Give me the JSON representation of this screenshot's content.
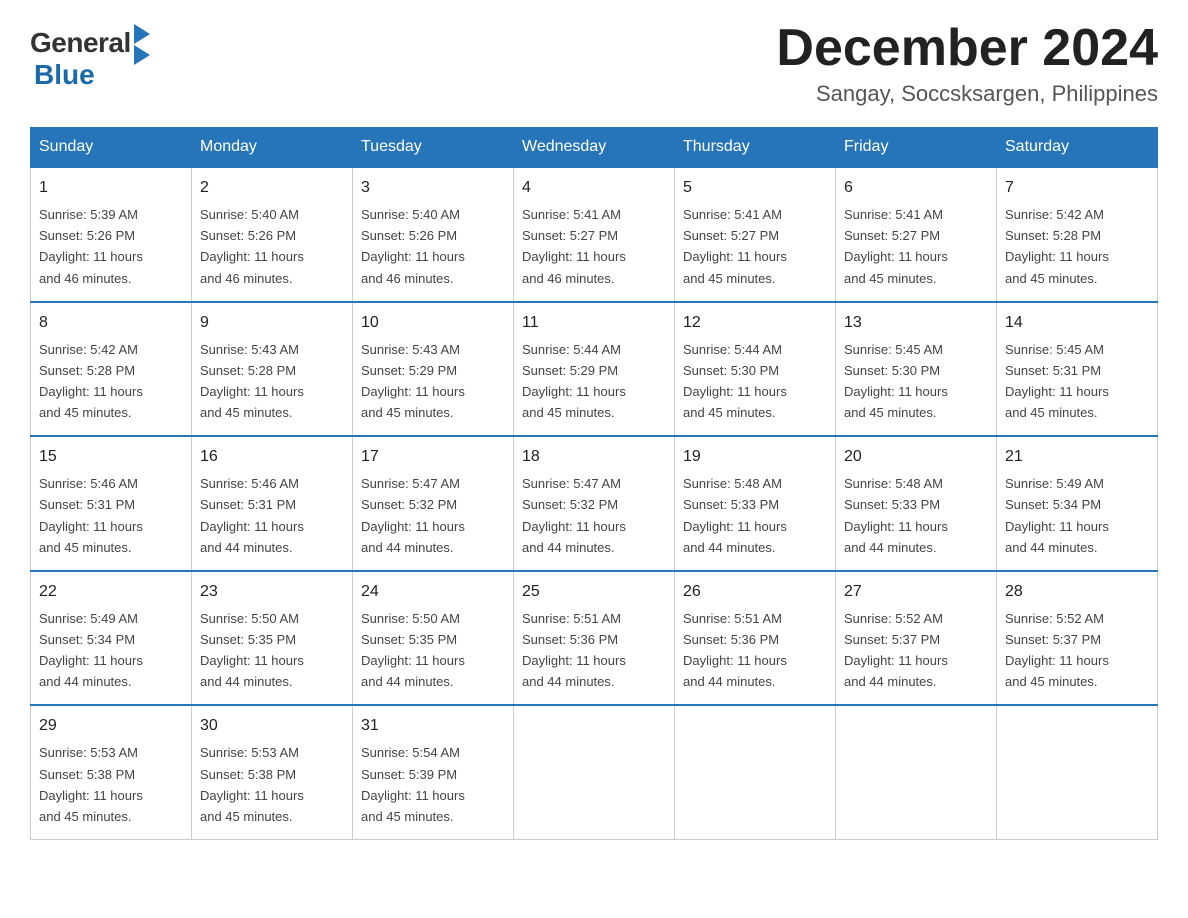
{
  "header": {
    "logo": {
      "general": "General",
      "blue": "Blue",
      "tagline": "Blue"
    },
    "title": "December 2024",
    "subtitle": "Sangay, Soccsksargen, Philippines"
  },
  "weekdays": [
    "Sunday",
    "Monday",
    "Tuesday",
    "Wednesday",
    "Thursday",
    "Friday",
    "Saturday"
  ],
  "weeks": [
    [
      {
        "day": "1",
        "sunrise": "5:39 AM",
        "sunset": "5:26 PM",
        "daylight": "11 hours and 46 minutes."
      },
      {
        "day": "2",
        "sunrise": "5:40 AM",
        "sunset": "5:26 PM",
        "daylight": "11 hours and 46 minutes."
      },
      {
        "day": "3",
        "sunrise": "5:40 AM",
        "sunset": "5:26 PM",
        "daylight": "11 hours and 46 minutes."
      },
      {
        "day": "4",
        "sunrise": "5:41 AM",
        "sunset": "5:27 PM",
        "daylight": "11 hours and 46 minutes."
      },
      {
        "day": "5",
        "sunrise": "5:41 AM",
        "sunset": "5:27 PM",
        "daylight": "11 hours and 45 minutes."
      },
      {
        "day": "6",
        "sunrise": "5:41 AM",
        "sunset": "5:27 PM",
        "daylight": "11 hours and 45 minutes."
      },
      {
        "day": "7",
        "sunrise": "5:42 AM",
        "sunset": "5:28 PM",
        "daylight": "11 hours and 45 minutes."
      }
    ],
    [
      {
        "day": "8",
        "sunrise": "5:42 AM",
        "sunset": "5:28 PM",
        "daylight": "11 hours and 45 minutes."
      },
      {
        "day": "9",
        "sunrise": "5:43 AM",
        "sunset": "5:28 PM",
        "daylight": "11 hours and 45 minutes."
      },
      {
        "day": "10",
        "sunrise": "5:43 AM",
        "sunset": "5:29 PM",
        "daylight": "11 hours and 45 minutes."
      },
      {
        "day": "11",
        "sunrise": "5:44 AM",
        "sunset": "5:29 PM",
        "daylight": "11 hours and 45 minutes."
      },
      {
        "day": "12",
        "sunrise": "5:44 AM",
        "sunset": "5:30 PM",
        "daylight": "11 hours and 45 minutes."
      },
      {
        "day": "13",
        "sunrise": "5:45 AM",
        "sunset": "5:30 PM",
        "daylight": "11 hours and 45 minutes."
      },
      {
        "day": "14",
        "sunrise": "5:45 AM",
        "sunset": "5:31 PM",
        "daylight": "11 hours and 45 minutes."
      }
    ],
    [
      {
        "day": "15",
        "sunrise": "5:46 AM",
        "sunset": "5:31 PM",
        "daylight": "11 hours and 45 minutes."
      },
      {
        "day": "16",
        "sunrise": "5:46 AM",
        "sunset": "5:31 PM",
        "daylight": "11 hours and 44 minutes."
      },
      {
        "day": "17",
        "sunrise": "5:47 AM",
        "sunset": "5:32 PM",
        "daylight": "11 hours and 44 minutes."
      },
      {
        "day": "18",
        "sunrise": "5:47 AM",
        "sunset": "5:32 PM",
        "daylight": "11 hours and 44 minutes."
      },
      {
        "day": "19",
        "sunrise": "5:48 AM",
        "sunset": "5:33 PM",
        "daylight": "11 hours and 44 minutes."
      },
      {
        "day": "20",
        "sunrise": "5:48 AM",
        "sunset": "5:33 PM",
        "daylight": "11 hours and 44 minutes."
      },
      {
        "day": "21",
        "sunrise": "5:49 AM",
        "sunset": "5:34 PM",
        "daylight": "11 hours and 44 minutes."
      }
    ],
    [
      {
        "day": "22",
        "sunrise": "5:49 AM",
        "sunset": "5:34 PM",
        "daylight": "11 hours and 44 minutes."
      },
      {
        "day": "23",
        "sunrise": "5:50 AM",
        "sunset": "5:35 PM",
        "daylight": "11 hours and 44 minutes."
      },
      {
        "day": "24",
        "sunrise": "5:50 AM",
        "sunset": "5:35 PM",
        "daylight": "11 hours and 44 minutes."
      },
      {
        "day": "25",
        "sunrise": "5:51 AM",
        "sunset": "5:36 PM",
        "daylight": "11 hours and 44 minutes."
      },
      {
        "day": "26",
        "sunrise": "5:51 AM",
        "sunset": "5:36 PM",
        "daylight": "11 hours and 44 minutes."
      },
      {
        "day": "27",
        "sunrise": "5:52 AM",
        "sunset": "5:37 PM",
        "daylight": "11 hours and 44 minutes."
      },
      {
        "day": "28",
        "sunrise": "5:52 AM",
        "sunset": "5:37 PM",
        "daylight": "11 hours and 45 minutes."
      }
    ],
    [
      {
        "day": "29",
        "sunrise": "5:53 AM",
        "sunset": "5:38 PM",
        "daylight": "11 hours and 45 minutes."
      },
      {
        "day": "30",
        "sunrise": "5:53 AM",
        "sunset": "5:38 PM",
        "daylight": "11 hours and 45 minutes."
      },
      {
        "day": "31",
        "sunrise": "5:54 AM",
        "sunset": "5:39 PM",
        "daylight": "11 hours and 45 minutes."
      },
      null,
      null,
      null,
      null
    ]
  ],
  "labels": {
    "sunrise": "Sunrise:",
    "sunset": "Sunset:",
    "daylight": "Daylight:"
  }
}
